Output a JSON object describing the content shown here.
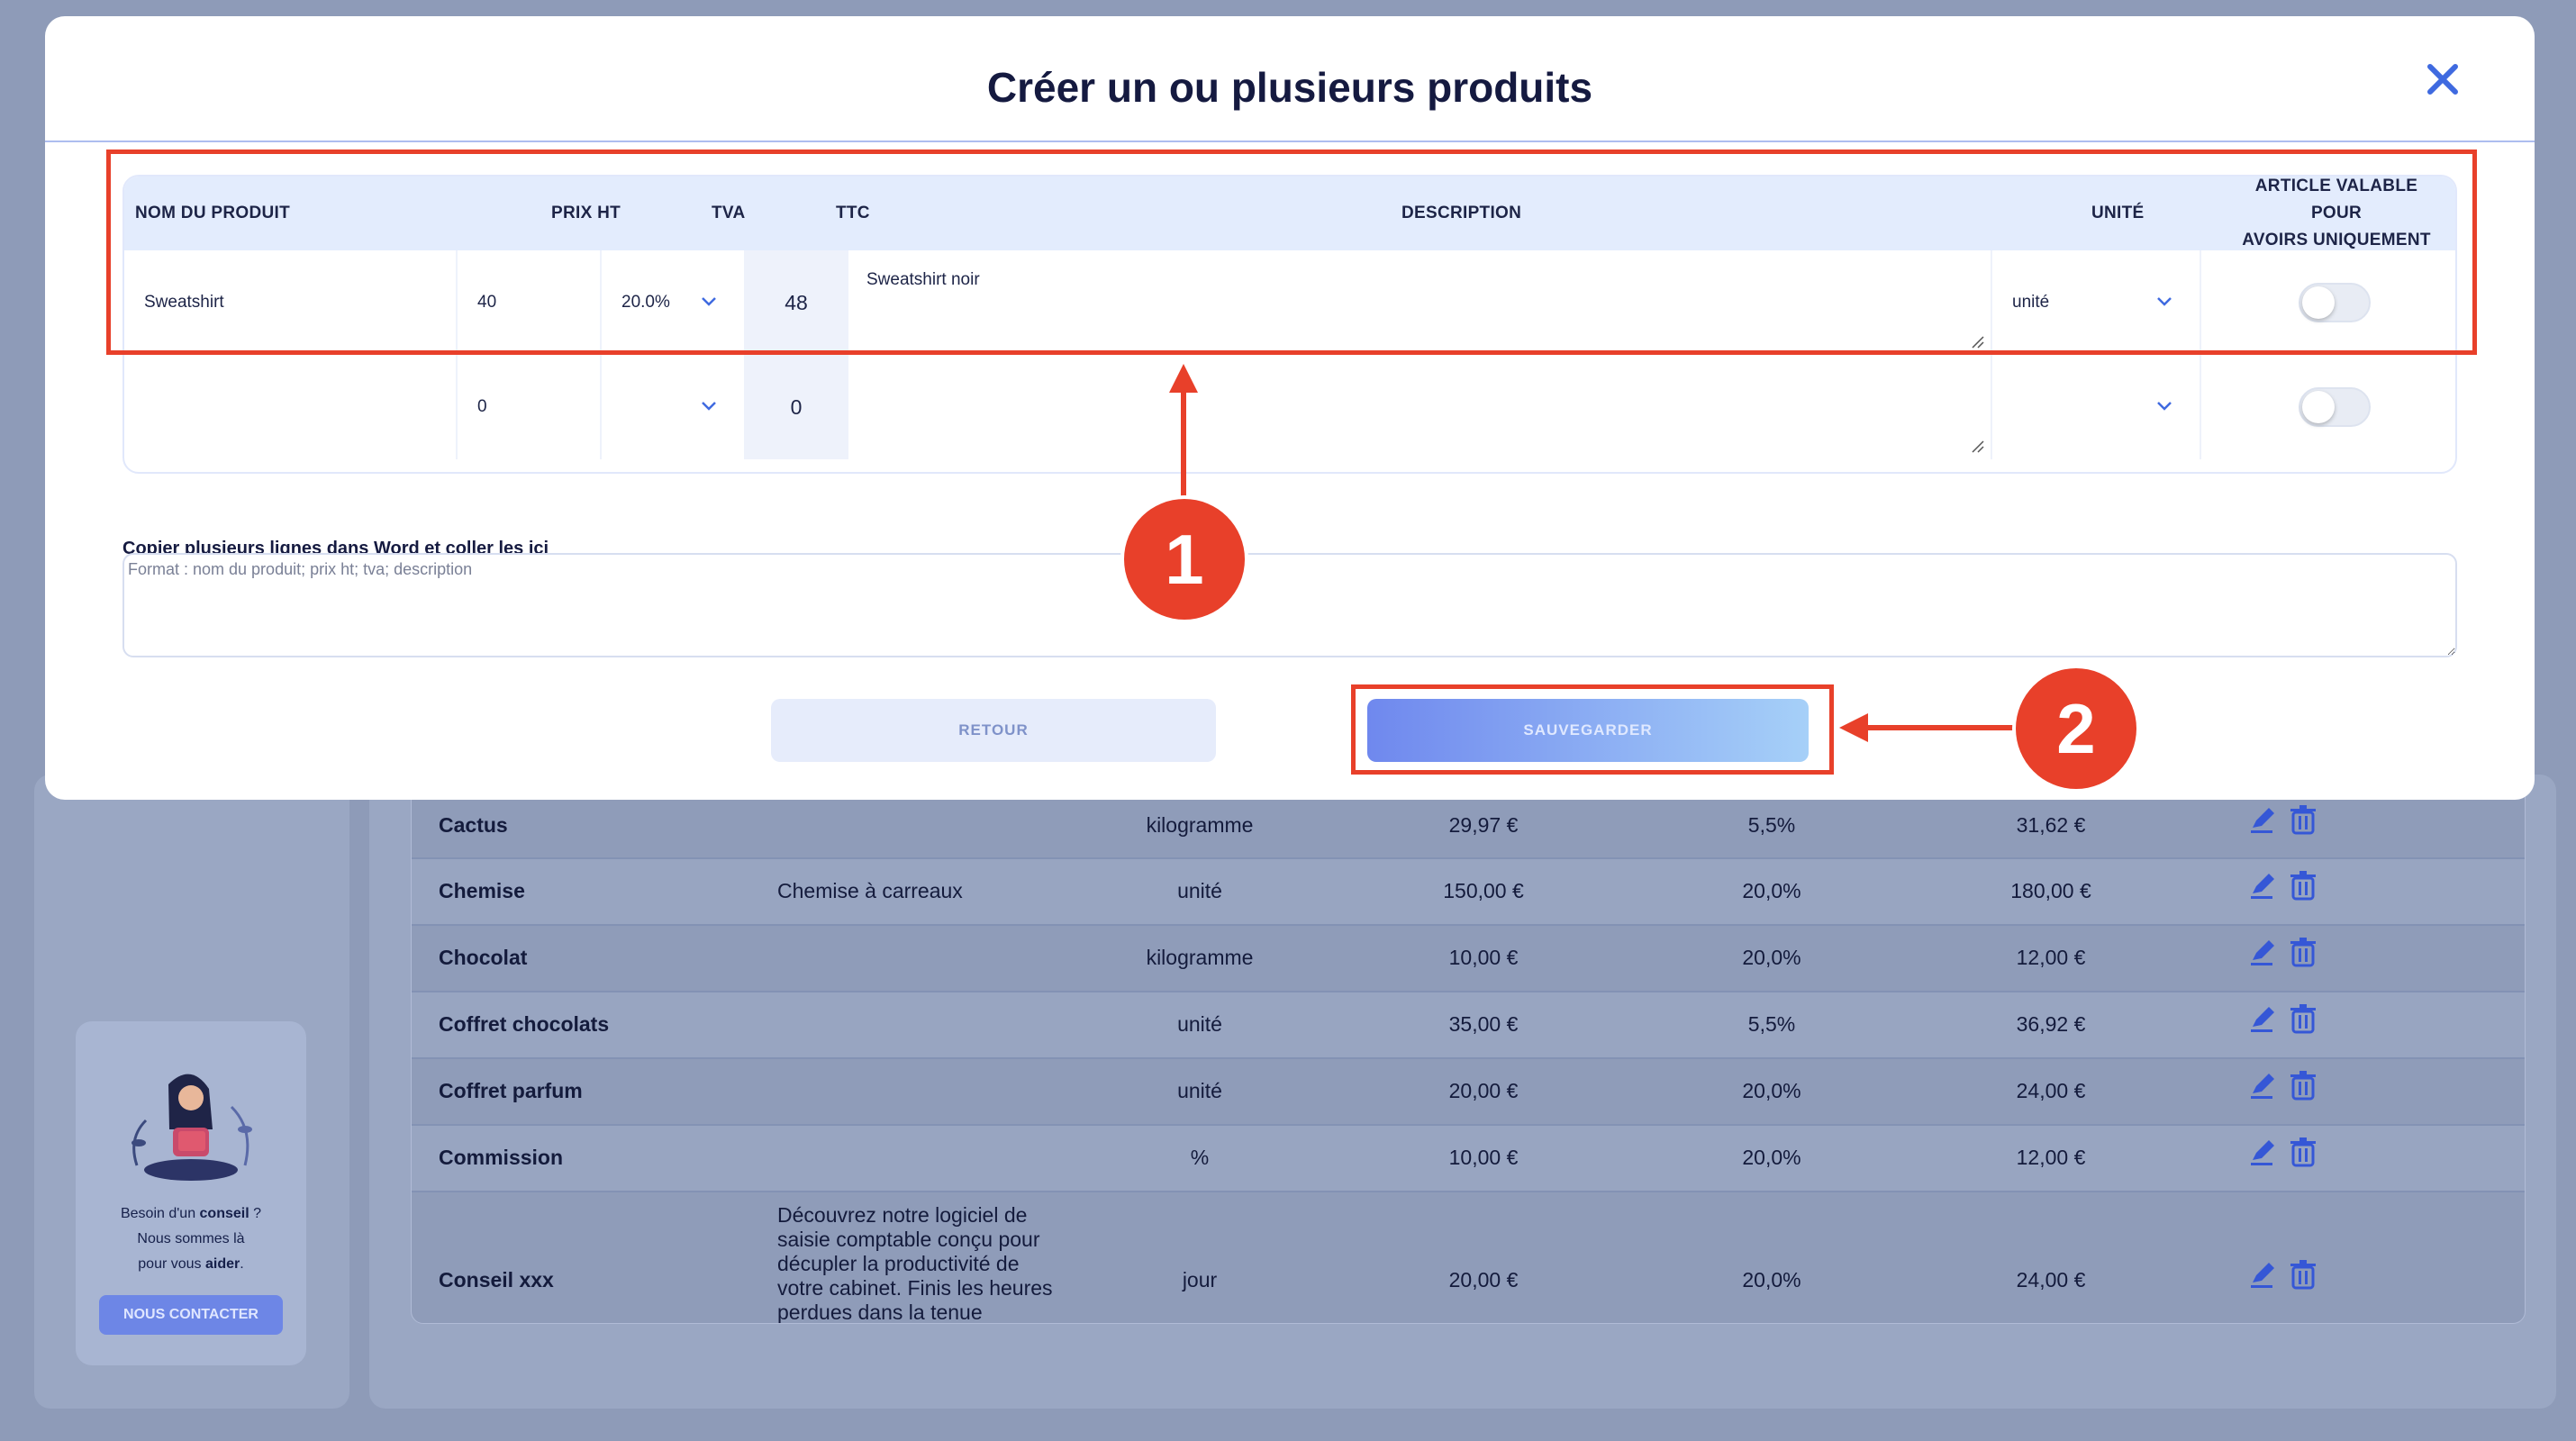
{
  "modal": {
    "title": "Créer un ou plusieurs produits",
    "close_icon": "close-icon",
    "columns": {
      "name": "NOM DU PRODUIT",
      "prix_ht": "PRIX HT",
      "tva": "TVA",
      "ttc": "TTC",
      "description": "DESCRIPTION",
      "unite": "UNITÉ",
      "article_valable_line1": "ARTICLE VALABLE POUR",
      "article_valable_line2": "AVOIRS UNIQUEMENT"
    },
    "rows": [
      {
        "name": "Sweatshirt",
        "prix_ht": "40",
        "tva": "20.0%",
        "ttc": "48",
        "description": "Sweatshirt noir",
        "unite": "unité",
        "avoirs_only": false
      },
      {
        "name": "",
        "prix_ht": "0",
        "tva": "",
        "ttc": "0",
        "description": "",
        "unite": "",
        "avoirs_only": false
      }
    ],
    "paste": {
      "label": "Copier plusieurs lignes dans Word et coller les ici",
      "placeholder": "Format : nom du produit; prix ht; tva; description"
    },
    "buttons": {
      "retour": "RETOUR",
      "sauvegarder": "SAUVEGARDER"
    }
  },
  "annotations": {
    "badge1": "1",
    "badge2": "2",
    "color": "#e8402a"
  },
  "background_table": {
    "rows": [
      {
        "name": "Cactus",
        "description": "",
        "unite": "kilogramme",
        "prix_ht": "29,97 €",
        "tva": "5,5%",
        "ttc": "31,62 €"
      },
      {
        "name": "Chemise",
        "description": "Chemise à carreaux",
        "unite": "unité",
        "prix_ht": "150,00 €",
        "tva": "20,0%",
        "ttc": "180,00 €"
      },
      {
        "name": "Chocolat",
        "description": "",
        "unite": "kilogramme",
        "prix_ht": "10,00 €",
        "tva": "20,0%",
        "ttc": "12,00 €"
      },
      {
        "name": "Coffret chocolats",
        "description": "",
        "unite": "unité",
        "prix_ht": "35,00 €",
        "tva": "5,5%",
        "ttc": "36,92 €"
      },
      {
        "name": "Coffret parfum",
        "description": "",
        "unite": "unité",
        "prix_ht": "20,00 €",
        "tva": "20,0%",
        "ttc": "24,00 €"
      },
      {
        "name": "Commission",
        "description": "",
        "unite": "%",
        "prix_ht": "10,00 €",
        "tva": "20,0%",
        "ttc": "12,00 €"
      },
      {
        "name": "Conseil xxx",
        "description": "Découvrez notre logiciel de saisie comptable conçu pour décupler la productivité de votre cabinet. Finis les heures perdues dans la tenue",
        "unite": "jour",
        "prix_ht": "20,00 €",
        "tva": "20,0%",
        "ttc": "24,00 €"
      }
    ]
  },
  "help_card": {
    "line1_prefix": "Besoin d'un ",
    "line1_bold": "conseil",
    "line1_suffix": " ?",
    "line2": "Nous sommes là",
    "line3_prefix": "pour vous ",
    "line3_bold": "aider",
    "line3_suffix": ".",
    "button": "NOUS CONTACTER"
  }
}
